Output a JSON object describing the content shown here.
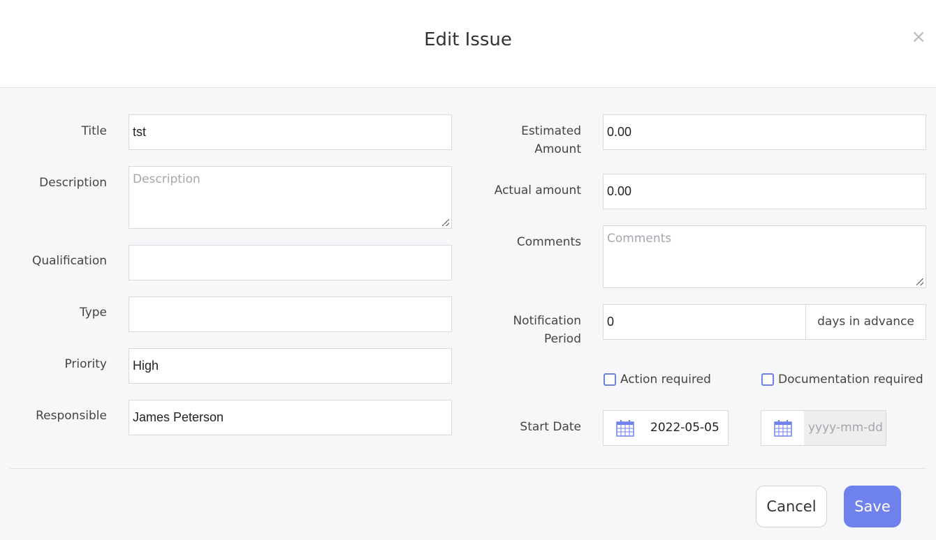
{
  "modal": {
    "title": "Edit Issue",
    "close_glyph": "×"
  },
  "left": {
    "title": {
      "label": "Title",
      "value": "tst"
    },
    "description": {
      "label": "Description",
      "placeholder": "Description"
    },
    "qualification": {
      "label": "Qualification",
      "value": ""
    },
    "type": {
      "label": "Type",
      "value": ""
    },
    "priority": {
      "label": "Priority",
      "value": "High"
    },
    "responsible": {
      "label": "Responsible",
      "value": "James Peterson"
    }
  },
  "right": {
    "estimated_amount": {
      "label_line1": "Estimated",
      "label_line2": "Amount",
      "value": "0.00"
    },
    "actual_amount": {
      "label": "Actual amount",
      "value": "0.00"
    },
    "comments": {
      "label": "Comments",
      "placeholder": "Comments"
    },
    "notification_period": {
      "label_line1": "Notification",
      "label_line2": "Period",
      "value": "0",
      "suffix": "days in advance"
    },
    "action_required": {
      "label": "Action required",
      "checked": false
    },
    "documentation_required": {
      "label": "Documentation required",
      "checked": false
    },
    "start_date": {
      "label": "Start Date",
      "value": "2022-05-05"
    },
    "end_date": {
      "placeholder": "yyyy-mm-dd"
    }
  },
  "buttons": {
    "cancel": "Cancel",
    "save": "Save"
  },
  "icons": {
    "close": "close-icon",
    "calendar": "calendar-icon"
  },
  "colors": {
    "accent": "#6f81ec",
    "checkbox_border": "#6f7fe6"
  }
}
